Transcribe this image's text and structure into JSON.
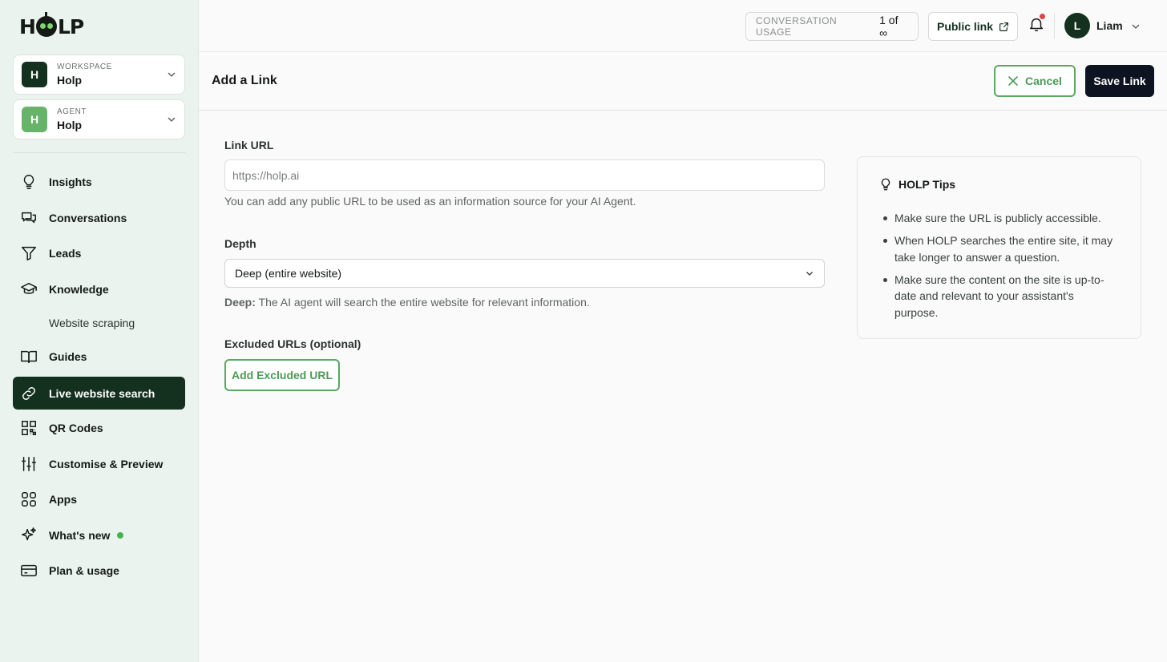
{
  "app": {
    "logo": "HOLP"
  },
  "sidebar": {
    "workspace": {
      "caption": "WORKSPACE",
      "badge": "H",
      "name": "Holp",
      "badge_color": "#14301f"
    },
    "agent": {
      "caption": "AGENT",
      "badge": "H",
      "name": "Holp",
      "badge_color": "#67b36a"
    },
    "items": [
      {
        "label": "Insights",
        "icon": "lightbulb-icon"
      },
      {
        "label": "Conversations",
        "icon": "chat-bubbles-icon"
      },
      {
        "label": "Leads",
        "icon": "funnel-icon"
      },
      {
        "label": "Knowledge",
        "icon": "graduation-cap-icon"
      },
      {
        "label": "Website scraping",
        "icon": null
      },
      {
        "label": "Guides",
        "icon": "book-icon"
      },
      {
        "label": "Live website search",
        "icon": "link-icon",
        "active": true
      },
      {
        "label": "QR Codes",
        "icon": "qr-code-icon"
      },
      {
        "label": "Customise & Preview",
        "icon": "sliders-icon"
      },
      {
        "label": "Apps",
        "icon": "apps-grid-icon"
      },
      {
        "label": "What's new",
        "icon": "sparkles-icon",
        "indicator": true
      },
      {
        "label": "Plan & usage",
        "icon": "credit-card-icon"
      }
    ]
  },
  "topbar": {
    "usage_label": "CONVERSATION USAGE",
    "usage_value": "1 of ∞",
    "public_link": "Public link",
    "user_initial": "L",
    "user_name": "Liam"
  },
  "header": {
    "title": "Add a Link",
    "cancel": "Cancel",
    "save": "Save Link"
  },
  "form": {
    "url_label": "Link URL",
    "url_placeholder": "https://holp.ai",
    "url_value": "",
    "url_help": "You can add any public URL to be used as an information source for your AI Agent.",
    "depth_label": "Depth",
    "depth_value": "Deep (entire website)",
    "depth_help_strong": "Deep:",
    "depth_help": "The AI agent will search the entire website for relevant information.",
    "excluded_label": "Excluded URLs (optional)",
    "add_excluded": "Add Excluded URL"
  },
  "tips": {
    "title": "HOLP Tips",
    "items": [
      "Make sure the URL is publicly accessible.",
      "When HOLP searches the entire site, it may take longer to answer a question.",
      "Make sure the content on the site is up-to-date and relevant to your assistant's purpose."
    ]
  }
}
